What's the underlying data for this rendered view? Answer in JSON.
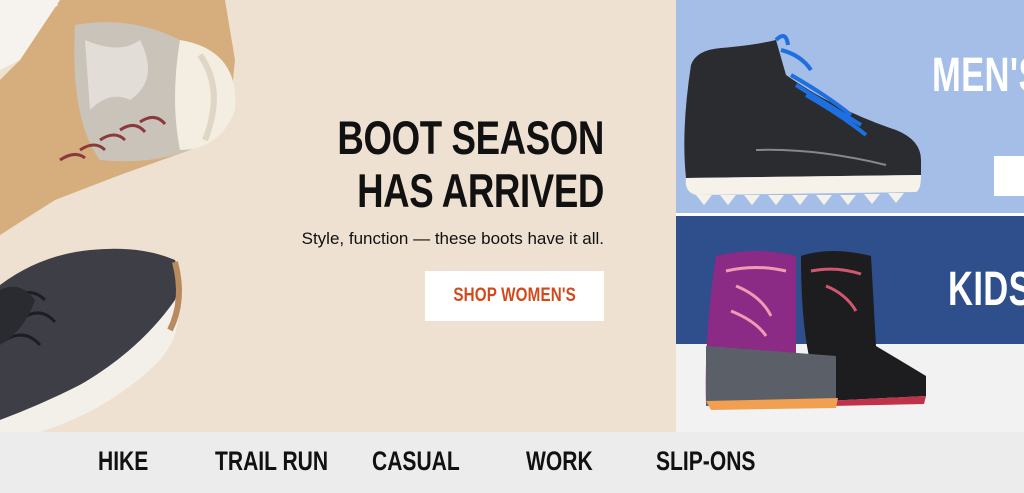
{
  "hero": {
    "headline": "BOOT SEASON HAS ARRIVED",
    "subhead": "Style, function — these boots have it all.",
    "cta_label": "SHOP WOMEN'S",
    "background": "#efe1d1",
    "cta_color": "#d24a1c"
  },
  "tiles": {
    "men": {
      "title": "MEN'S",
      "background": "#a4bee8"
    },
    "kids": {
      "title": "KIDS'",
      "background": "#2f4f8c"
    }
  },
  "nav": {
    "items": [
      {
        "label": "HIKE"
      },
      {
        "label": "TRAIL RUN"
      },
      {
        "label": "CASUAL"
      },
      {
        "label": "WORK"
      },
      {
        "label": "SLIP-ONS"
      }
    ],
    "background": "#ececec"
  }
}
